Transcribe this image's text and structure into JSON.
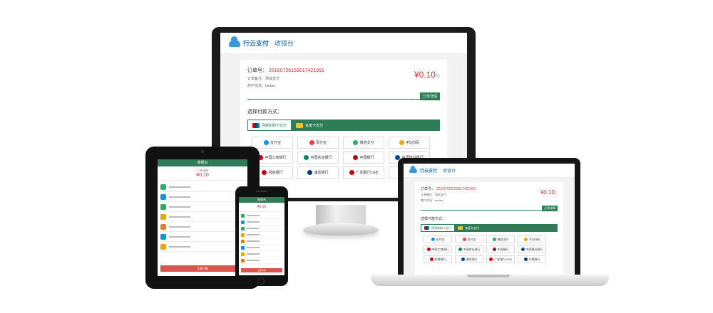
{
  "app": {
    "brand": "行云支付",
    "cashier": "收银台"
  },
  "order": {
    "label": "订单号：",
    "number": "20160726153017421991",
    "remark": "订单备注：测试支付",
    "merchant": "商户信息：testaa",
    "amount": "¥0.10",
    "unit": "元",
    "detail_button": "订单详情"
  },
  "payment": {
    "section_title": "选择付款方式：",
    "tabs": [
      "网银和刷卡支付",
      "充值卡支付"
    ],
    "methods": [
      {
        "label": "支付宝",
        "color": "#1296db"
      },
      {
        "label": "百付宝",
        "color": "#e64340"
      },
      {
        "label": "微信支付",
        "color": "#2aae67"
      },
      {
        "label": "手Q扫码",
        "color": "#f0a30a"
      },
      {
        "label": "中国工商银行",
        "color": "#c7000b"
      },
      {
        "label": "中国农业银行",
        "color": "#00875a"
      },
      {
        "label": "中国银行",
        "color": "#b40a1e"
      },
      {
        "label": "中国建设银行",
        "color": "#0a4a9e"
      },
      {
        "label": "招商银行",
        "color": "#c7000b"
      },
      {
        "label": "浦发银行",
        "color": "#0a3a8a"
      },
      {
        "label": "广发银行CGB",
        "color": "#c7000b"
      },
      {
        "label": "",
        "color": "#ffffff"
      }
    ],
    "laptop_methods": [
      {
        "label": "支付宝",
        "color": "#1296db"
      },
      {
        "label": "百付宝",
        "color": "#e64340"
      },
      {
        "label": "微信支付",
        "color": "#2aae67"
      },
      {
        "label": "手Q扫码",
        "color": "#f0a30a"
      },
      {
        "label": "中国工商银行",
        "color": "#c7000b"
      },
      {
        "label": "中国农业银行",
        "color": "#00875a"
      },
      {
        "label": "中国银行",
        "color": "#b40a1e"
      },
      {
        "label": "中国建设银行",
        "color": "#0a4a9e"
      },
      {
        "label": "招商银行",
        "color": "#c7000b"
      },
      {
        "label": "浦发银行",
        "color": "#0a3a8a"
      },
      {
        "label": "广发银行CGB",
        "color": "#c7000b"
      },
      {
        "label": "交通银行",
        "color": "#0a3a8a"
      }
    ]
  },
  "mobile": {
    "header": "收银台",
    "amount_label": "订单金额",
    "amount": "¥0.10",
    "pay_button": "立即付款",
    "row_colors": [
      "#2aae67",
      "#1296db",
      "#2aae67",
      "#f0a30a",
      "#e67e22",
      "#1296db",
      "#f0a30a",
      "#e67e22"
    ]
  },
  "colors": {
    "accent": "#2f7d57",
    "price": "#cc3333",
    "brand": "#2a7ab5"
  }
}
